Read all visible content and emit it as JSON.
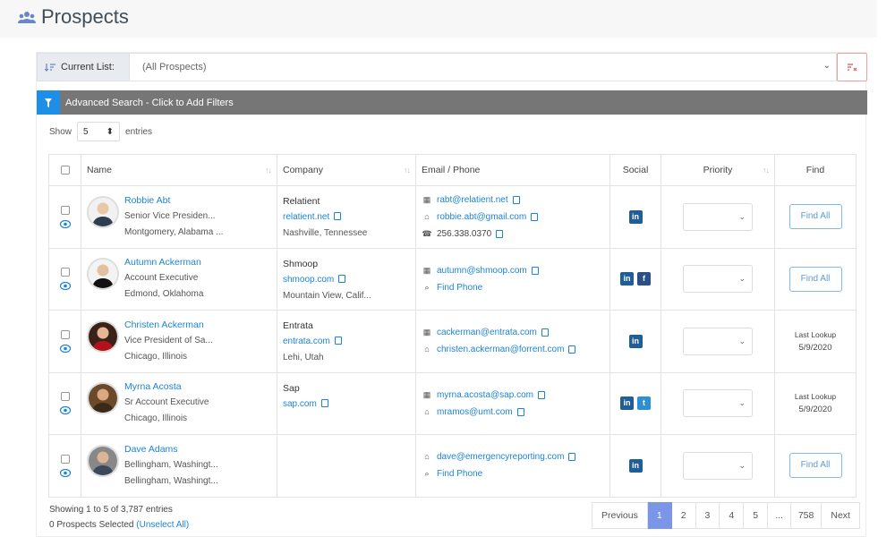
{
  "page": {
    "title": "Prospects"
  },
  "current_list": {
    "label": "Current List:",
    "value": "(All Prospects)"
  },
  "advanced_search": {
    "label": "Advanced Search - Click to Add Filters"
  },
  "entries": {
    "show": "Show",
    "value": "5",
    "suffix": "entries"
  },
  "table": {
    "headers": {
      "name": "Name",
      "company": "Company",
      "email_phone": "Email / Phone",
      "social": "Social",
      "priority": "Priority",
      "find": "Find"
    },
    "rows": [
      {
        "name": "Robbie Abt",
        "title": "Senior Vice Presiden...",
        "location": "Montgomery, Alabama ...",
        "company": "Relatient",
        "company_domain": "relatient.net",
        "company_location": "Nashville, Tennessee",
        "contacts": [
          {
            "icon": "building-icon",
            "glyph": "▦",
            "value": "rabt@relatient.net",
            "link": true
          },
          {
            "icon": "home-icon",
            "glyph": "⌂",
            "value": "robbie.abt@gmail.com",
            "link": true
          },
          {
            "icon": "phone-icon",
            "glyph": "☎",
            "value": "256.338.0370",
            "link": false
          }
        ],
        "social": [
          "in"
        ],
        "find_all": "Find All"
      },
      {
        "name": "Autumn Ackerman",
        "title": "Account Executive",
        "location": "Edmond, Oklahoma",
        "company": "Shmoop",
        "company_domain": "shmoop.com",
        "company_location": "Mountain View, Calif...",
        "contacts": [
          {
            "icon": "building-icon",
            "glyph": "▦",
            "value": "autumn@shmoop.com",
            "link": true
          },
          {
            "icon": "search-phone-icon",
            "glyph": "⌕",
            "value": "Find Phone",
            "link": true
          }
        ],
        "social": [
          "in",
          "f"
        ],
        "find_all": "Find All"
      },
      {
        "name": "Christen Ackerman",
        "title": "Vice President of Sa...",
        "location": "Chicago, Illinois",
        "company": "Entrata",
        "company_domain": "entrata.com",
        "company_location": "Lehi, Utah",
        "contacts": [
          {
            "icon": "building-icon",
            "glyph": "▦",
            "value": "cackerman@entrata.com",
            "link": true
          },
          {
            "icon": "home-icon",
            "glyph": "⌂",
            "value": "christen.ackerman@forrent.com",
            "link": true
          }
        ],
        "social": [
          "in"
        ],
        "last_lookup_label": "Last Lookup",
        "last_lookup_date": "5/9/2020"
      },
      {
        "name": "Myrna Acosta",
        "title": "Sr Account Executive",
        "location": "Chicago, Illinois",
        "company": "Sap",
        "company_domain": "sap.com",
        "company_location": "",
        "contacts": [
          {
            "icon": "building-icon",
            "glyph": "▦",
            "value": "myrna.acosta@sap.com",
            "link": true
          },
          {
            "icon": "home-icon",
            "glyph": "⌂",
            "value": "mramos@umt.com",
            "link": true
          }
        ],
        "social": [
          "in",
          "t"
        ],
        "last_lookup_label": "Last Lookup",
        "last_lookup_date": "5/9/2020"
      },
      {
        "name": "Dave Adams",
        "title": "Bellingham, Washingt...",
        "location": "Bellingham, Washingt...",
        "company": "",
        "company_domain": "",
        "company_location": "",
        "contacts": [
          {
            "icon": "home-icon",
            "glyph": "⌂",
            "value": "dave@emergencyreporting.com",
            "link": true
          },
          {
            "icon": "search-phone-icon",
            "glyph": "⌕",
            "value": "Find Phone",
            "link": true
          }
        ],
        "social": [
          "in"
        ],
        "find_all": "Find All"
      }
    ]
  },
  "footer": {
    "showing": "Showing 1 to 5 of 3,787 entries",
    "selected": "0 Prospects Selected",
    "unselect": "(Unselect All)"
  },
  "pagination": [
    "Previous",
    "1",
    "2",
    "3",
    "4",
    "5",
    "...",
    "758",
    "Next"
  ],
  "pagination_active": "1",
  "colors": {
    "accent": "#1c84d6",
    "linkedin": "#1f5e96",
    "facebook": "#2b5089",
    "twitter": "#2d8fd6",
    "advanced_bar": "#767676",
    "filter_icon_bg": "#1e8fe8",
    "pager_active": "#7b95e8"
  }
}
